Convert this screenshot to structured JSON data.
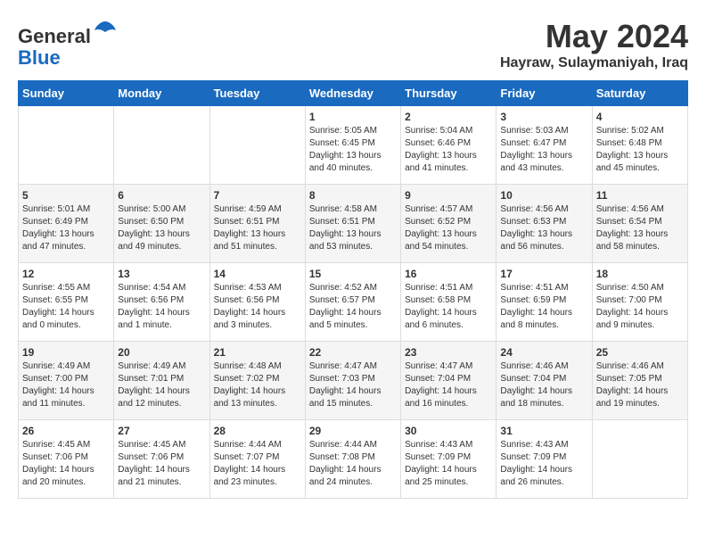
{
  "header": {
    "logo_line1": "General",
    "logo_line2": "Blue",
    "month_title": "May 2024",
    "location": "Hayraw, Sulaymaniyah, Iraq"
  },
  "days_of_week": [
    "Sunday",
    "Monday",
    "Tuesday",
    "Wednesday",
    "Thursday",
    "Friday",
    "Saturday"
  ],
  "weeks": [
    [
      {
        "day": "",
        "info": ""
      },
      {
        "day": "",
        "info": ""
      },
      {
        "day": "",
        "info": ""
      },
      {
        "day": "1",
        "info": "Sunrise: 5:05 AM\nSunset: 6:45 PM\nDaylight: 13 hours\nand 40 minutes."
      },
      {
        "day": "2",
        "info": "Sunrise: 5:04 AM\nSunset: 6:46 PM\nDaylight: 13 hours\nand 41 minutes."
      },
      {
        "day": "3",
        "info": "Sunrise: 5:03 AM\nSunset: 6:47 PM\nDaylight: 13 hours\nand 43 minutes."
      },
      {
        "day": "4",
        "info": "Sunrise: 5:02 AM\nSunset: 6:48 PM\nDaylight: 13 hours\nand 45 minutes."
      }
    ],
    [
      {
        "day": "5",
        "info": "Sunrise: 5:01 AM\nSunset: 6:49 PM\nDaylight: 13 hours\nand 47 minutes."
      },
      {
        "day": "6",
        "info": "Sunrise: 5:00 AM\nSunset: 6:50 PM\nDaylight: 13 hours\nand 49 minutes."
      },
      {
        "day": "7",
        "info": "Sunrise: 4:59 AM\nSunset: 6:51 PM\nDaylight: 13 hours\nand 51 minutes."
      },
      {
        "day": "8",
        "info": "Sunrise: 4:58 AM\nSunset: 6:51 PM\nDaylight: 13 hours\nand 53 minutes."
      },
      {
        "day": "9",
        "info": "Sunrise: 4:57 AM\nSunset: 6:52 PM\nDaylight: 13 hours\nand 54 minutes."
      },
      {
        "day": "10",
        "info": "Sunrise: 4:56 AM\nSunset: 6:53 PM\nDaylight: 13 hours\nand 56 minutes."
      },
      {
        "day": "11",
        "info": "Sunrise: 4:56 AM\nSunset: 6:54 PM\nDaylight: 13 hours\nand 58 minutes."
      }
    ],
    [
      {
        "day": "12",
        "info": "Sunrise: 4:55 AM\nSunset: 6:55 PM\nDaylight: 14 hours\nand 0 minutes."
      },
      {
        "day": "13",
        "info": "Sunrise: 4:54 AM\nSunset: 6:56 PM\nDaylight: 14 hours\nand 1 minute."
      },
      {
        "day": "14",
        "info": "Sunrise: 4:53 AM\nSunset: 6:56 PM\nDaylight: 14 hours\nand 3 minutes."
      },
      {
        "day": "15",
        "info": "Sunrise: 4:52 AM\nSunset: 6:57 PM\nDaylight: 14 hours\nand 5 minutes."
      },
      {
        "day": "16",
        "info": "Sunrise: 4:51 AM\nSunset: 6:58 PM\nDaylight: 14 hours\nand 6 minutes."
      },
      {
        "day": "17",
        "info": "Sunrise: 4:51 AM\nSunset: 6:59 PM\nDaylight: 14 hours\nand 8 minutes."
      },
      {
        "day": "18",
        "info": "Sunrise: 4:50 AM\nSunset: 7:00 PM\nDaylight: 14 hours\nand 9 minutes."
      }
    ],
    [
      {
        "day": "19",
        "info": "Sunrise: 4:49 AM\nSunset: 7:00 PM\nDaylight: 14 hours\nand 11 minutes."
      },
      {
        "day": "20",
        "info": "Sunrise: 4:49 AM\nSunset: 7:01 PM\nDaylight: 14 hours\nand 12 minutes."
      },
      {
        "day": "21",
        "info": "Sunrise: 4:48 AM\nSunset: 7:02 PM\nDaylight: 14 hours\nand 13 minutes."
      },
      {
        "day": "22",
        "info": "Sunrise: 4:47 AM\nSunset: 7:03 PM\nDaylight: 14 hours\nand 15 minutes."
      },
      {
        "day": "23",
        "info": "Sunrise: 4:47 AM\nSunset: 7:04 PM\nDaylight: 14 hours\nand 16 minutes."
      },
      {
        "day": "24",
        "info": "Sunrise: 4:46 AM\nSunset: 7:04 PM\nDaylight: 14 hours\nand 18 minutes."
      },
      {
        "day": "25",
        "info": "Sunrise: 4:46 AM\nSunset: 7:05 PM\nDaylight: 14 hours\nand 19 minutes."
      }
    ],
    [
      {
        "day": "26",
        "info": "Sunrise: 4:45 AM\nSunset: 7:06 PM\nDaylight: 14 hours\nand 20 minutes."
      },
      {
        "day": "27",
        "info": "Sunrise: 4:45 AM\nSunset: 7:06 PM\nDaylight: 14 hours\nand 21 minutes."
      },
      {
        "day": "28",
        "info": "Sunrise: 4:44 AM\nSunset: 7:07 PM\nDaylight: 14 hours\nand 23 minutes."
      },
      {
        "day": "29",
        "info": "Sunrise: 4:44 AM\nSunset: 7:08 PM\nDaylight: 14 hours\nand 24 minutes."
      },
      {
        "day": "30",
        "info": "Sunrise: 4:43 AM\nSunset: 7:09 PM\nDaylight: 14 hours\nand 25 minutes."
      },
      {
        "day": "31",
        "info": "Sunrise: 4:43 AM\nSunset: 7:09 PM\nDaylight: 14 hours\nand 26 minutes."
      },
      {
        "day": "",
        "info": ""
      }
    ]
  ]
}
